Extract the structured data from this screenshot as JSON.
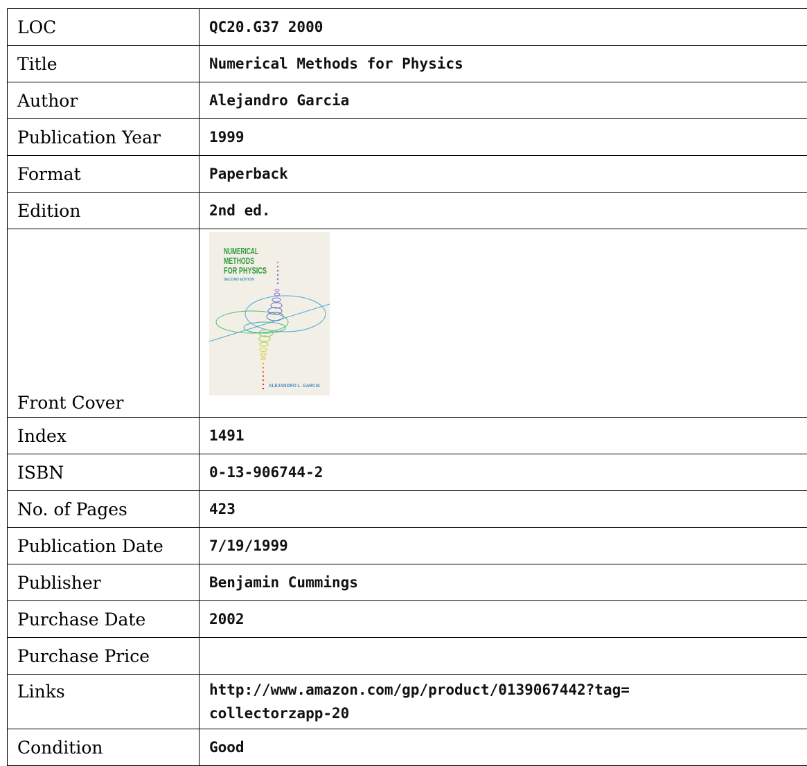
{
  "rows": [
    {
      "label": "LOC",
      "value": "QC20.G37 2000"
    },
    {
      "label": "Title",
      "value": "Numerical Methods for Physics"
    },
    {
      "label": "Author",
      "value": "Alejandro Garcia"
    },
    {
      "label": "Publication Year",
      "value": "1999"
    },
    {
      "label": "Format",
      "value": "Paperback"
    },
    {
      "label": "Edition",
      "value": "2nd ed."
    },
    {
      "label": "Front Cover",
      "cover": {
        "title_lines": [
          "NUMERICAL",
          "METHODS",
          "FOR PHYSICS"
        ],
        "edition": "SECOND EDITION",
        "author": "ALEJANDRO L. GARCIA",
        "background": "#f2efe6",
        "title_color": "#2e9a3c"
      }
    },
    {
      "label": "Index",
      "value": "1491"
    },
    {
      "label": "ISBN",
      "value": "0-13-906744-2"
    },
    {
      "label": "No. of Pages",
      "value": "423"
    },
    {
      "label": "Publication Date",
      "value": "7/19/1999"
    },
    {
      "label": "Publisher",
      "value": "Benjamin Cummings"
    },
    {
      "label": "Purchase Date",
      "value": "2002"
    },
    {
      "label": "Purchase Price",
      "value": ""
    },
    {
      "label": "Links",
      "value": "http://www.amazon.com/gp/product/0139067442?tag=collectorzapp-20",
      "value_lines": [
        "http://www.amazon.com/gp/product/0139067442?tag=",
        "collectorzapp-20"
      ]
    },
    {
      "label": "Condition",
      "value": "Good"
    }
  ]
}
